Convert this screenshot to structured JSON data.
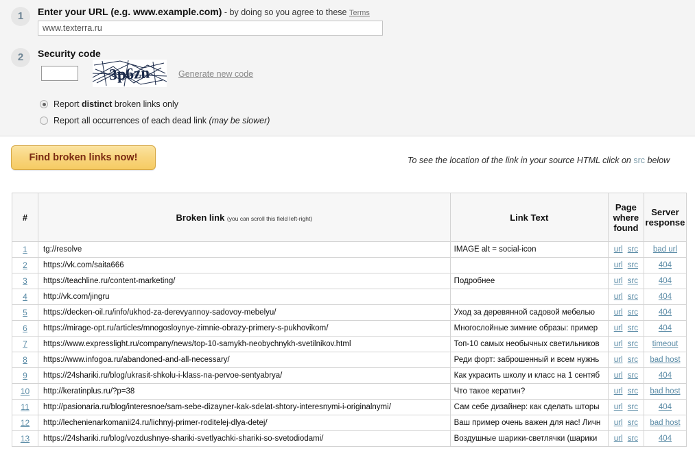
{
  "form": {
    "step1": {
      "number": "1",
      "title_strong": "Enter your URL (e.g. www.example.com)",
      "title_rest": " - by doing so you agree to these ",
      "terms_label": "Terms",
      "url_value": "www.texterra.ru",
      "url_placeholder": "www.example.com"
    },
    "step2": {
      "number": "2",
      "title": "Security code",
      "captcha_value": "",
      "captcha_placeholder": "",
      "captcha_text": "3p6zn",
      "generate_label": "Generate new code"
    },
    "radios": [
      {
        "prefix": "Report ",
        "strong": "distinct",
        "suffix": " broken links only",
        "italic": "",
        "selected": true
      },
      {
        "prefix": "Report all occurrences of each dead link ",
        "strong": "",
        "suffix": "",
        "italic": "(may be slower)",
        "selected": false
      }
    ]
  },
  "action": {
    "find_button_label": "Find broken links now!",
    "hint_before": "To see the location of the link in your source HTML click on ",
    "hint_src": "src",
    "hint_after": " below"
  },
  "table": {
    "headers": {
      "num": "#",
      "broken_link": "Broken link",
      "broken_link_hint": "(you can scroll this field left-right)",
      "link_text": "Link Text",
      "page_where_found": "Page where found",
      "server_response": "Server response"
    },
    "page_links": {
      "url": "url",
      "src": "src"
    },
    "rows": [
      {
        "num": "1",
        "link": "tg://resolve",
        "text": "IMAGE alt = social-icon",
        "response": "bad url"
      },
      {
        "num": "2",
        "link": "https://vk.com/saita666",
        "text": "",
        "response": "404"
      },
      {
        "num": "3",
        "link": "https://teachline.ru/content-marketing/",
        "text": "Подробнее",
        "response": "404"
      },
      {
        "num": "4",
        "link": "http://vk.com/jingru",
        "text": "",
        "response": "404"
      },
      {
        "num": "5",
        "link": "https://decken-oil.ru/info/ukhod-za-derevyannoy-sadovoy-mebelyu/",
        "text": "Уход за деревянной садовой мебелью",
        "response": "404"
      },
      {
        "num": "6",
        "link": "https://mirage-opt.ru/articles/mnogosloynye-zimnie-obrazy-primery-s-pukhovikom/",
        "text": "Многослойные зимние образы: пример",
        "response": "404"
      },
      {
        "num": "7",
        "link": "https://www.expresslight.ru/company/news/top-10-samykh-neobychnykh-svetilnikov.html",
        "text": "Топ-10 самых необычных светильников",
        "response": "timeout"
      },
      {
        "num": "8",
        "link": "https://www.infogoa.ru/abandoned-and-all-necessary/",
        "text": "Реди форт: заброшенный и всем нужнь",
        "response": "bad host"
      },
      {
        "num": "9",
        "link": "https://24shariki.ru/blog/ukrasit-shkolu-i-klass-na-pervoe-sentyabrya/",
        "text": "Как украсить школу и класс на 1 сентяб",
        "response": "404"
      },
      {
        "num": "10",
        "link": "http://keratinplus.ru/?p=38",
        "text": "Что такое кератин?",
        "response": "bad host"
      },
      {
        "num": "11",
        "link": "http://pasionaria.ru/blog/interesnoe/sam-sebe-dizayner-kak-sdelat-shtory-interesnymi-i-originalnymi/",
        "text": "Сам себе дизайнер: как сделать шторы",
        "response": "404"
      },
      {
        "num": "12",
        "link": "http://lechenienarkomanii24.ru/lichnyj-primer-roditelej-dlya-detej/",
        "text": "Ваш пример очень важен для нас! Личн",
        "response": "bad host"
      },
      {
        "num": "13",
        "link": "https://24shariki.ru/blog/vozdushnye-shariki-svetlyachki-shariki-so-svetodiodami/",
        "text": "Воздушные шарики-светлячки (шарики",
        "response": "404"
      }
    ]
  },
  "colors": {
    "link": "#5a8ba6",
    "button_text": "#7a2a12",
    "button_bg": "#f8d57e",
    "panel_bg": "#f4f4f4",
    "header_bg": "#f7f7f7"
  }
}
